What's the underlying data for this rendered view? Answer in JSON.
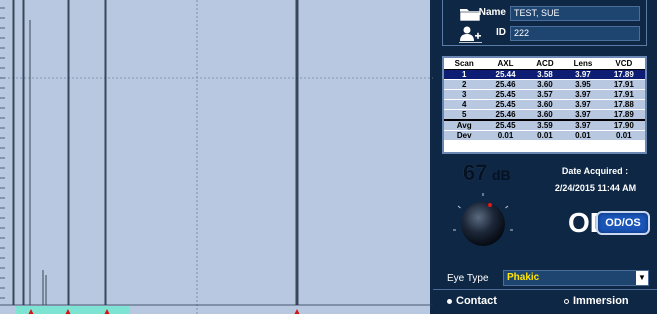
{
  "patient": {
    "name_label": "Name",
    "name_value": "TEST, SUE",
    "id_label": "ID",
    "id_value": "222",
    "folder_icon": "folder-icon",
    "add_user_icon": "add-user-icon"
  },
  "measurements": {
    "columns": [
      "Scan",
      "AXL",
      "ACD",
      "Lens",
      "VCD"
    ],
    "rows": [
      [
        "1",
        "25.44",
        "3.58",
        "3.97",
        "17.89"
      ],
      [
        "2",
        "25.46",
        "3.60",
        "3.95",
        "17.91"
      ],
      [
        "3",
        "25.45",
        "3.57",
        "3.97",
        "17.91"
      ],
      [
        "4",
        "25.45",
        "3.60",
        "3.97",
        "17.88"
      ],
      [
        "5",
        "25.46",
        "3.60",
        "3.97",
        "17.89"
      ]
    ],
    "selected_row": 0,
    "stats": [
      [
        "Avg",
        "25.45",
        "3.59",
        "3.97",
        "17.90"
      ],
      [
        "Dev",
        "0.01",
        "0.01",
        "0.01",
        "0.01"
      ]
    ]
  },
  "gain": {
    "value": "67",
    "unit": "dB"
  },
  "date": {
    "label": "Date Acquired :",
    "value": "2/24/2015 11:44 AM"
  },
  "eye": {
    "label": "OD",
    "toggle_label": "OD/OS"
  },
  "eye_type": {
    "label": "Eye Type",
    "value": "Phakic"
  },
  "mode": {
    "contact_label": "Contact",
    "immersion_label": "Immersion",
    "selected": "contact"
  },
  "colors": {
    "panel_bg": "#0e2744",
    "scan_bg": "#b8c8e0",
    "selected_row": "#0d1d73",
    "eye_type_value": "#ffe800",
    "toggle_button": "#1a55b8"
  }
}
